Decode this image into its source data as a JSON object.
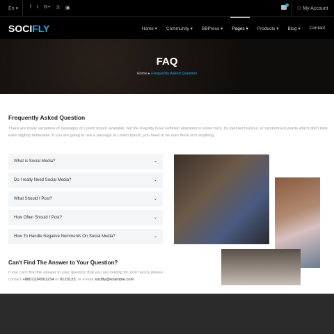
{
  "topbar": {
    "language": "En",
    "social_icons": [
      "facebook-icon",
      "twitter-icon",
      "google-plus-icon",
      "rss-icon",
      "youtube-icon"
    ],
    "account": "My Account"
  },
  "nav": {
    "logo_a": "SOCI",
    "logo_b": "FLY",
    "items": [
      "Home",
      "Community",
      "BBPress",
      "Pages",
      "Products",
      "Blog",
      "Contact"
    ],
    "active": "Pages"
  },
  "hero": {
    "title": "FAQ",
    "breadcrumb_home": "Home",
    "breadcrumb_sep": "▸",
    "breadcrumb_current": "Frequently Asked Question"
  },
  "main": {
    "title": "Frequently Asked Question",
    "intro": "There are many variations of passages of Lorem Ipsum available, but the majority have suffered alteration in some form, by injected humour, or randomised words which don't look even slightly believable. If you are going to use a passage of Lorem Ipsum, you need to be sure there isn't anything.",
    "faqs": [
      "What is Social Media?",
      "Do I really Need Social Media?",
      "What Should I Post?",
      "How Often Should I Post?",
      "How To Handle Negative Nomments On Social Media?"
    ],
    "help_title": "Can't Find The Answer to Your Question?",
    "help_text": "If you can't find the answer to your question that you are looking for, don't worry please contact ",
    "phone1": "+8801234561234",
    "or": " or ",
    "phone2": "0123123",
    "email_pre": ", or e-mail ",
    "email": "socifly@example.com"
  },
  "colors": {
    "accent": "#29a9e0",
    "nav_bg": "#000000",
    "footer_bg": "#2b2b2b"
  }
}
